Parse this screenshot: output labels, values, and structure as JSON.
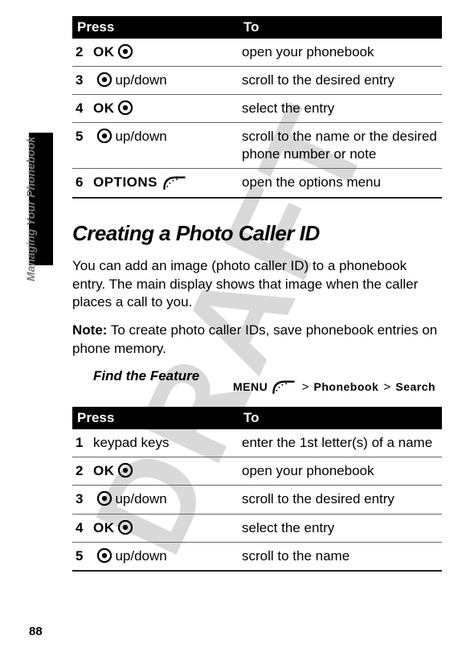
{
  "watermark": "DRAFT",
  "side_label": "Managing Your Phonebook",
  "page_number": "88",
  "table1": {
    "header_press": "Press",
    "header_to": "To",
    "rows": [
      {
        "idx": "2",
        "key_label": "OK",
        "icon": "nav",
        "suffix": "",
        "to": "open your phonebook"
      },
      {
        "idx": "3",
        "key_label": "",
        "icon": "nav",
        "suffix": " up/down",
        "to": "scroll to the desired entry"
      },
      {
        "idx": "4",
        "key_label": "OK",
        "icon": "nav",
        "suffix": "",
        "to": "select the entry"
      },
      {
        "idx": "5",
        "key_label": "",
        "icon": "nav",
        "suffix": " up/down",
        "to": "scroll to the name or the desired phone number or note"
      },
      {
        "idx": "6",
        "key_label": "OPTIONS",
        "icon": "soft",
        "suffix": "",
        "to": "open the options menu"
      }
    ]
  },
  "section_heading": "Creating a Photo Caller ID",
  "para1": "You can add an image (photo caller ID) to a phonebook entry. The main display shows that image when the caller places a call to you.",
  "note_label": "Note:",
  "note_text": " To create photo caller IDs, save phonebook entries on phone memory.",
  "find_feature_label": "Find the Feature",
  "menu_path": {
    "menu": "MENU",
    "seg1": "Phonebook",
    "seg2": "Search"
  },
  "table2": {
    "header_press": "Press",
    "header_to": "To",
    "rows": [
      {
        "idx": "1",
        "key_label": "",
        "icon": "",
        "suffix": "keypad keys",
        "to": "enter the 1st letter(s) of a name"
      },
      {
        "idx": "2",
        "key_label": "OK",
        "icon": "nav",
        "suffix": "",
        "to": "open your phonebook"
      },
      {
        "idx": "3",
        "key_label": "",
        "icon": "nav",
        "suffix": " up/down",
        "to": "scroll to the desired entry"
      },
      {
        "idx": "4",
        "key_label": "OK",
        "icon": "nav",
        "suffix": "",
        "to": "select the entry"
      },
      {
        "idx": "5",
        "key_label": "",
        "icon": "nav",
        "suffix": " up/down",
        "to": "scroll to the name"
      }
    ]
  }
}
